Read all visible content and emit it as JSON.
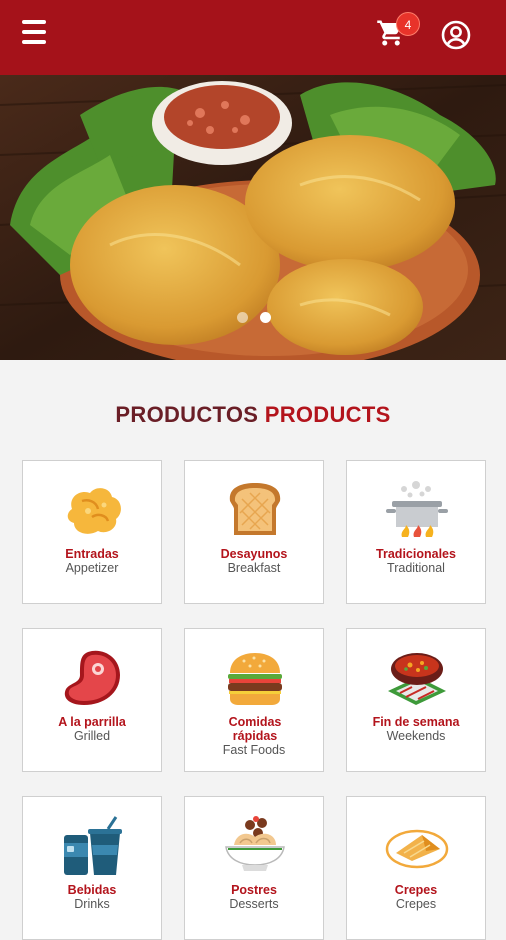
{
  "header": {
    "cart_count": "4"
  },
  "slider": {
    "slides": 2,
    "active_slide": 2
  },
  "section": {
    "title_es": "PRODUCTOS",
    "title_en": "PRODUCTS"
  },
  "categories": [
    {
      "es": "Entradas",
      "en": "Appetizer",
      "icon": "appetizer-icon"
    },
    {
      "es": "Desayunos",
      "en": "Breakfast",
      "icon": "toast-icon"
    },
    {
      "es": "Tradicionales",
      "en": "Traditional",
      "icon": "pot-icon"
    },
    {
      "es": "A la parrilla",
      "en": "Grilled",
      "icon": "steak-icon"
    },
    {
      "es": "Comidas rápidas",
      "en": "Fast Foods",
      "icon": "burger-icon"
    },
    {
      "es": "Fin de semana",
      "en": "Weekends",
      "icon": "soup-bowl-icon"
    },
    {
      "es": "Bebidas",
      "en": "Drinks",
      "icon": "drinks-icon"
    },
    {
      "es": "Postres",
      "en": "Desserts",
      "icon": "dessert-icon"
    },
    {
      "es": "Crepes",
      "en": "Crepes",
      "icon": "crepe-icon"
    }
  ],
  "colors": {
    "brand": "#a5121a",
    "accent": "#b3141c",
    "badge": "#e8332a"
  }
}
